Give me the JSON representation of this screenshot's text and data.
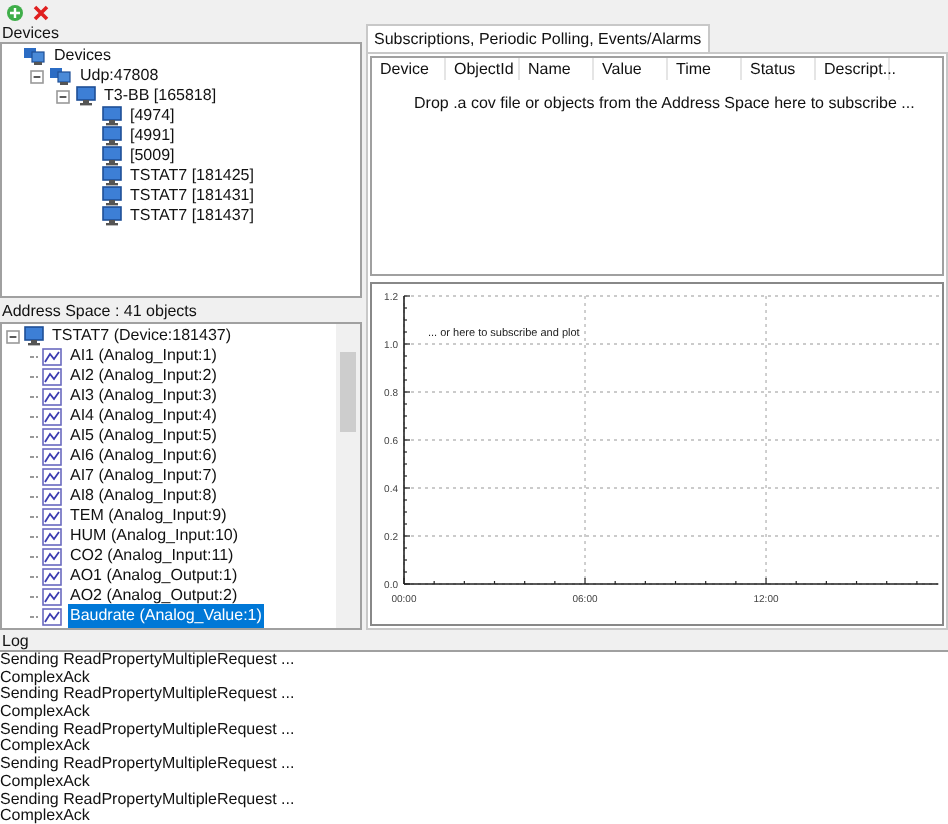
{
  "devices": {
    "label": "Devices",
    "tree": [
      {
        "label": "Devices",
        "kind": "root",
        "children": [
          {
            "label": "Udp:47808",
            "kind": "network",
            "expanded": true,
            "children": [
              {
                "label": "T3-BB [165818]",
                "kind": "device",
                "expanded": true,
                "children": [
                  {
                    "label": "[4974]",
                    "kind": "device"
                  },
                  {
                    "label": "[4991]",
                    "kind": "device"
                  },
                  {
                    "label": "[5009]",
                    "kind": "device"
                  },
                  {
                    "label": "TSTAT7 [181425]",
                    "kind": "device"
                  },
                  {
                    "label": "TSTAT7 [181431]",
                    "kind": "device"
                  },
                  {
                    "label": "TSTAT7 [181437]",
                    "kind": "device"
                  }
                ]
              }
            ]
          }
        ]
      }
    ]
  },
  "address_space": {
    "label": "Address Space : 41 objects",
    "device": {
      "label": "TSTAT7 (Device:181437)",
      "expanded": true
    },
    "objects": [
      {
        "label": "AI1 (Analog_Input:1)",
        "selected": false
      },
      {
        "label": "AI2 (Analog_Input:2)",
        "selected": false
      },
      {
        "label": "AI3 (Analog_Input:3)",
        "selected": false
      },
      {
        "label": "AI4 (Analog_Input:4)",
        "selected": false
      },
      {
        "label": "AI5 (Analog_Input:5)",
        "selected": false
      },
      {
        "label": "AI6 (Analog_Input:6)",
        "selected": false
      },
      {
        "label": "AI7 (Analog_Input:7)",
        "selected": false
      },
      {
        "label": "AI8 (Analog_Input:8)",
        "selected": false
      },
      {
        "label": "TEM (Analog_Input:9)",
        "selected": false
      },
      {
        "label": "HUM (Analog_Input:10)",
        "selected": false
      },
      {
        "label": "CO2 (Analog_Input:11)",
        "selected": false
      },
      {
        "label": "AO1 (Analog_Output:1)",
        "selected": false
      },
      {
        "label": "AO2 (Analog_Output:2)",
        "selected": false
      },
      {
        "label": "Baudrate  (Analog_Value:1)",
        "selected": true
      }
    ]
  },
  "tabs": [
    {
      "label": "Subscriptions, Periodic Polling, Events/Alarms",
      "selected": true
    }
  ],
  "subscriptions": {
    "columns": [
      "Device",
      "ObjectId",
      "Name",
      "Value",
      "Time",
      "Status",
      "Descript..."
    ],
    "empty_message": "Drop .a cov file or objects from the Address Space here to subscribe ..."
  },
  "plot": {
    "chart_data": {
      "type": "line",
      "grid": true,
      "xlim": [
        0,
        17.7
      ],
      "ylim": [
        0,
        1.2
      ],
      "yticks": [
        {
          "value": 0,
          "label": "0.0"
        },
        {
          "value": 0.2,
          "label": "0.2"
        },
        {
          "value": 0.4,
          "label": "0.4"
        },
        {
          "value": 0.6,
          "label": "0.6"
        },
        {
          "value": 0.8,
          "label": "0.8"
        },
        {
          "value": 1,
          "label": "1.0"
        },
        {
          "value": 1.2,
          "label": "1.2"
        }
      ],
      "xticks": [
        {
          "value": 0,
          "label": "00:00"
        },
        {
          "value": 6,
          "label": "06:00"
        },
        {
          "value": 12,
          "label": "12:00"
        }
      ],
      "annotations": [
        "... or here to subscribe and plot"
      ]
    }
  },
  "log": {
    "label": "Log",
    "lines": [
      "Sending ReadPropertyMultipleRequest ...",
      "ComplexAck",
      "Sending ReadPropertyMultipleRequest ...",
      "ComplexAck",
      "Sending ReadPropertyMultipleRequest ...",
      "ComplexAck",
      "Sending ReadPropertyMultipleRequest ...",
      "ComplexAck",
      "Sending ReadPropertyMultipleRequest ...",
      "ComplexAck"
    ]
  }
}
